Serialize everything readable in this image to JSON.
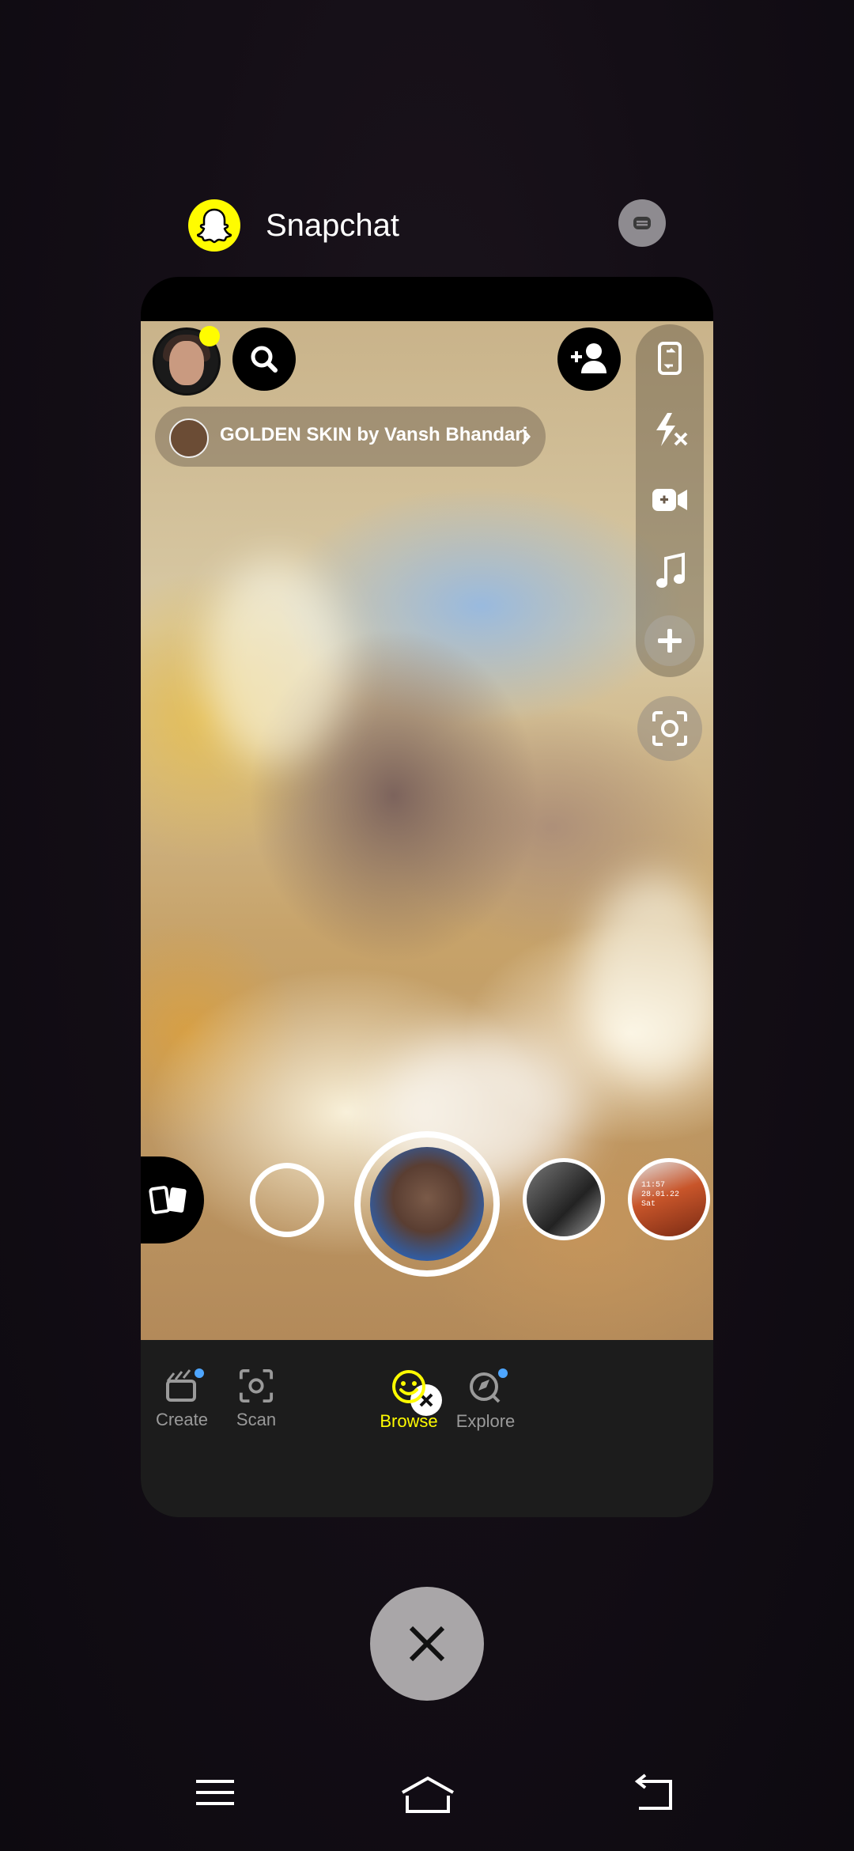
{
  "app_header": {
    "title": "Snapchat"
  },
  "camera": {
    "lens_chip": {
      "label": "GOLDEN SKIN by Vansh Bhandari"
    },
    "side_tools": [
      "flip-camera-icon",
      "flash-off-icon",
      "video-chat-icon",
      "music-note-icon",
      "plus-icon"
    ],
    "lens_thumb_text": "11:57\n28.01.22\nSat"
  },
  "bottom_nav": {
    "items": [
      {
        "label": "Create",
        "icon": "create-icon",
        "has_dot": true
      },
      {
        "label": "Scan",
        "icon": "scan-icon",
        "has_dot": false
      },
      {
        "label": "",
        "icon": "close-icon"
      },
      {
        "label": "Browse",
        "icon": "browse-smiley-icon",
        "active": true
      },
      {
        "label": "Explore",
        "icon": "explore-icon",
        "has_dot": true
      }
    ]
  },
  "colors": {
    "snap_yellow": "#FFFC00",
    "dot_blue": "#4ea6ff",
    "nav_bg": "#1c1c1c"
  },
  "system_nav": [
    "menu-icon",
    "home-icon",
    "back-icon"
  ]
}
